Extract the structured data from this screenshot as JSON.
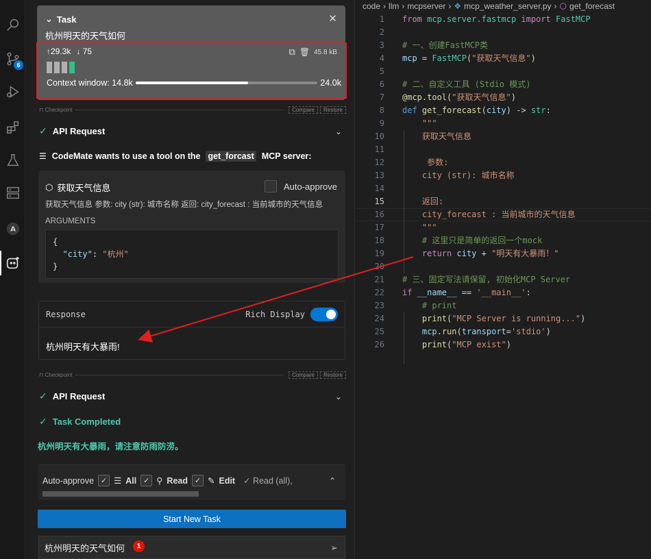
{
  "task": {
    "header": "Task",
    "question": "杭州明天的天气如何",
    "tokens_up": "29.3k",
    "tokens_down": "75",
    "size": "45.8 kB",
    "context_label": "Context window:",
    "context_used": "14.8k",
    "context_max": "24.0k",
    "context_fraction": 0.617
  },
  "checkpoint": {
    "label": "Checkpoint",
    "compare": "Compare",
    "restore": "Restore"
  },
  "api_request_1": "API Request",
  "tool_request": {
    "prefix": "CodeMate wants to use a tool on the",
    "server": "get_forcast",
    "suffix": "MCP server:"
  },
  "tool": {
    "name": "获取天气信息",
    "auto_approve": "Auto-approve",
    "description": "获取天气信息 参数: city (str): 城市名称 返回: city_forecast : 当前城市的天气信息",
    "args_label": "ARGUMENTS",
    "arg_open": "{",
    "arg_key": "\"city\"",
    "arg_colon": ": ",
    "arg_value": "\"杭州\"",
    "arg_close": "}"
  },
  "response": {
    "label": "Response",
    "rich_display": "Rich Display",
    "text": "杭州明天有大暴雨!"
  },
  "api_request_2": "API Request",
  "task_completed": "Task Completed",
  "final_message": "杭州明天有大暴雨，请注意防雨防涝。",
  "auto_approve_bar": {
    "label": "Auto-approve",
    "all": "All",
    "read": "Read",
    "edit": "Edit",
    "summary": "✓ Read (all),"
  },
  "start_new_task": "Start New Task",
  "input": {
    "value": "杭州明天的天气如何",
    "badge": "1"
  },
  "activity_badge": "6",
  "breadcrumb": {
    "p1": "code",
    "p2": "llm",
    "p3": "mcpserver",
    "p4": "mcp_weather_server.py",
    "p5": "get_forecast"
  },
  "editor": {
    "current_line": 15,
    "lines": [
      {
        "n": "1"
      },
      {
        "n": "2"
      },
      {
        "n": "3"
      },
      {
        "n": "4"
      },
      {
        "n": "5"
      },
      {
        "n": "6"
      },
      {
        "n": "7"
      },
      {
        "n": "8"
      },
      {
        "n": "9"
      },
      {
        "n": "10"
      },
      {
        "n": "11"
      },
      {
        "n": "12"
      },
      {
        "n": "13"
      },
      {
        "n": "14"
      },
      {
        "n": "15"
      },
      {
        "n": "16"
      },
      {
        "n": "17"
      },
      {
        "n": "18"
      },
      {
        "n": "19"
      },
      {
        "n": "20"
      },
      {
        "n": "21"
      },
      {
        "n": "22"
      },
      {
        "n": "23"
      },
      {
        "n": "24"
      },
      {
        "n": "25"
      },
      {
        "n": "26"
      }
    ],
    "code": {
      "l1a": "from",
      "l1b": " mcp.server.fastmcp ",
      "l1c": "import",
      "l1d": " FastMCP",
      "l3": "# 一、创建FastMCP类",
      "l4a": "mcp",
      "l4b": " = ",
      "l4c": "FastMCP",
      "l4d": "(",
      "l4e": "\"获取天气信息\"",
      "l4f": ")",
      "l6": "# 二、自定义工具 (Stdio 模式)",
      "l7a": "@mcp.tool",
      "l7b": "(",
      "l7c": "\"获取天气信息\"",
      "l7d": ")",
      "l8a": "def",
      "l8b": " ",
      "l8c": "get_forecast",
      "l8d": "(",
      "l8e": "city",
      "l8f": ") -> ",
      "l8g": "str",
      "l8h": ":",
      "l9": "    \"\"\"",
      "l10": "    获取天气信息",
      "l12": "     参数:",
      "l13": "    city (str): 城市名称",
      "l15": "    返回:",
      "l16": "    city_forecast : 当前城市的天气信息",
      "l17": "    \"\"\"",
      "l18": "    # 这里只是简单的返回一个mock",
      "l19a": "    ",
      "l19b": "return",
      "l19c": " city",
      "l19d": " + ",
      "l19e": "\"明天有大暴雨！\"",
      "l21": "# 三、固定写法请保留, 初始化MCP Server",
      "l22a": "if",
      "l22b": " __name__",
      "l22c": " == ",
      "l22d": "'__main__'",
      "l22e": ":",
      "l23": "    # print",
      "l24a": "    ",
      "l24b": "print",
      "l24c": "(",
      "l24d": "\"MCP Server is running...\"",
      "l24e": ")",
      "l25a": "    ",
      "l25b": "mcp",
      "l25c": ".",
      "l25d": "run",
      "l25e": "(",
      "l25f": "transport",
      "l25g": "=",
      "l25h": "'stdio'",
      "l25i": ")",
      "l26a": "    ",
      "l26b": "print",
      "l26c": "(",
      "l26d": "\"MCP exist\"",
      "l26e": ")"
    }
  },
  "colors": {
    "accent": "#0078d4",
    "highlight_box": "#e02020",
    "success": "#4ec9b0",
    "toggle": "#0078d4"
  }
}
